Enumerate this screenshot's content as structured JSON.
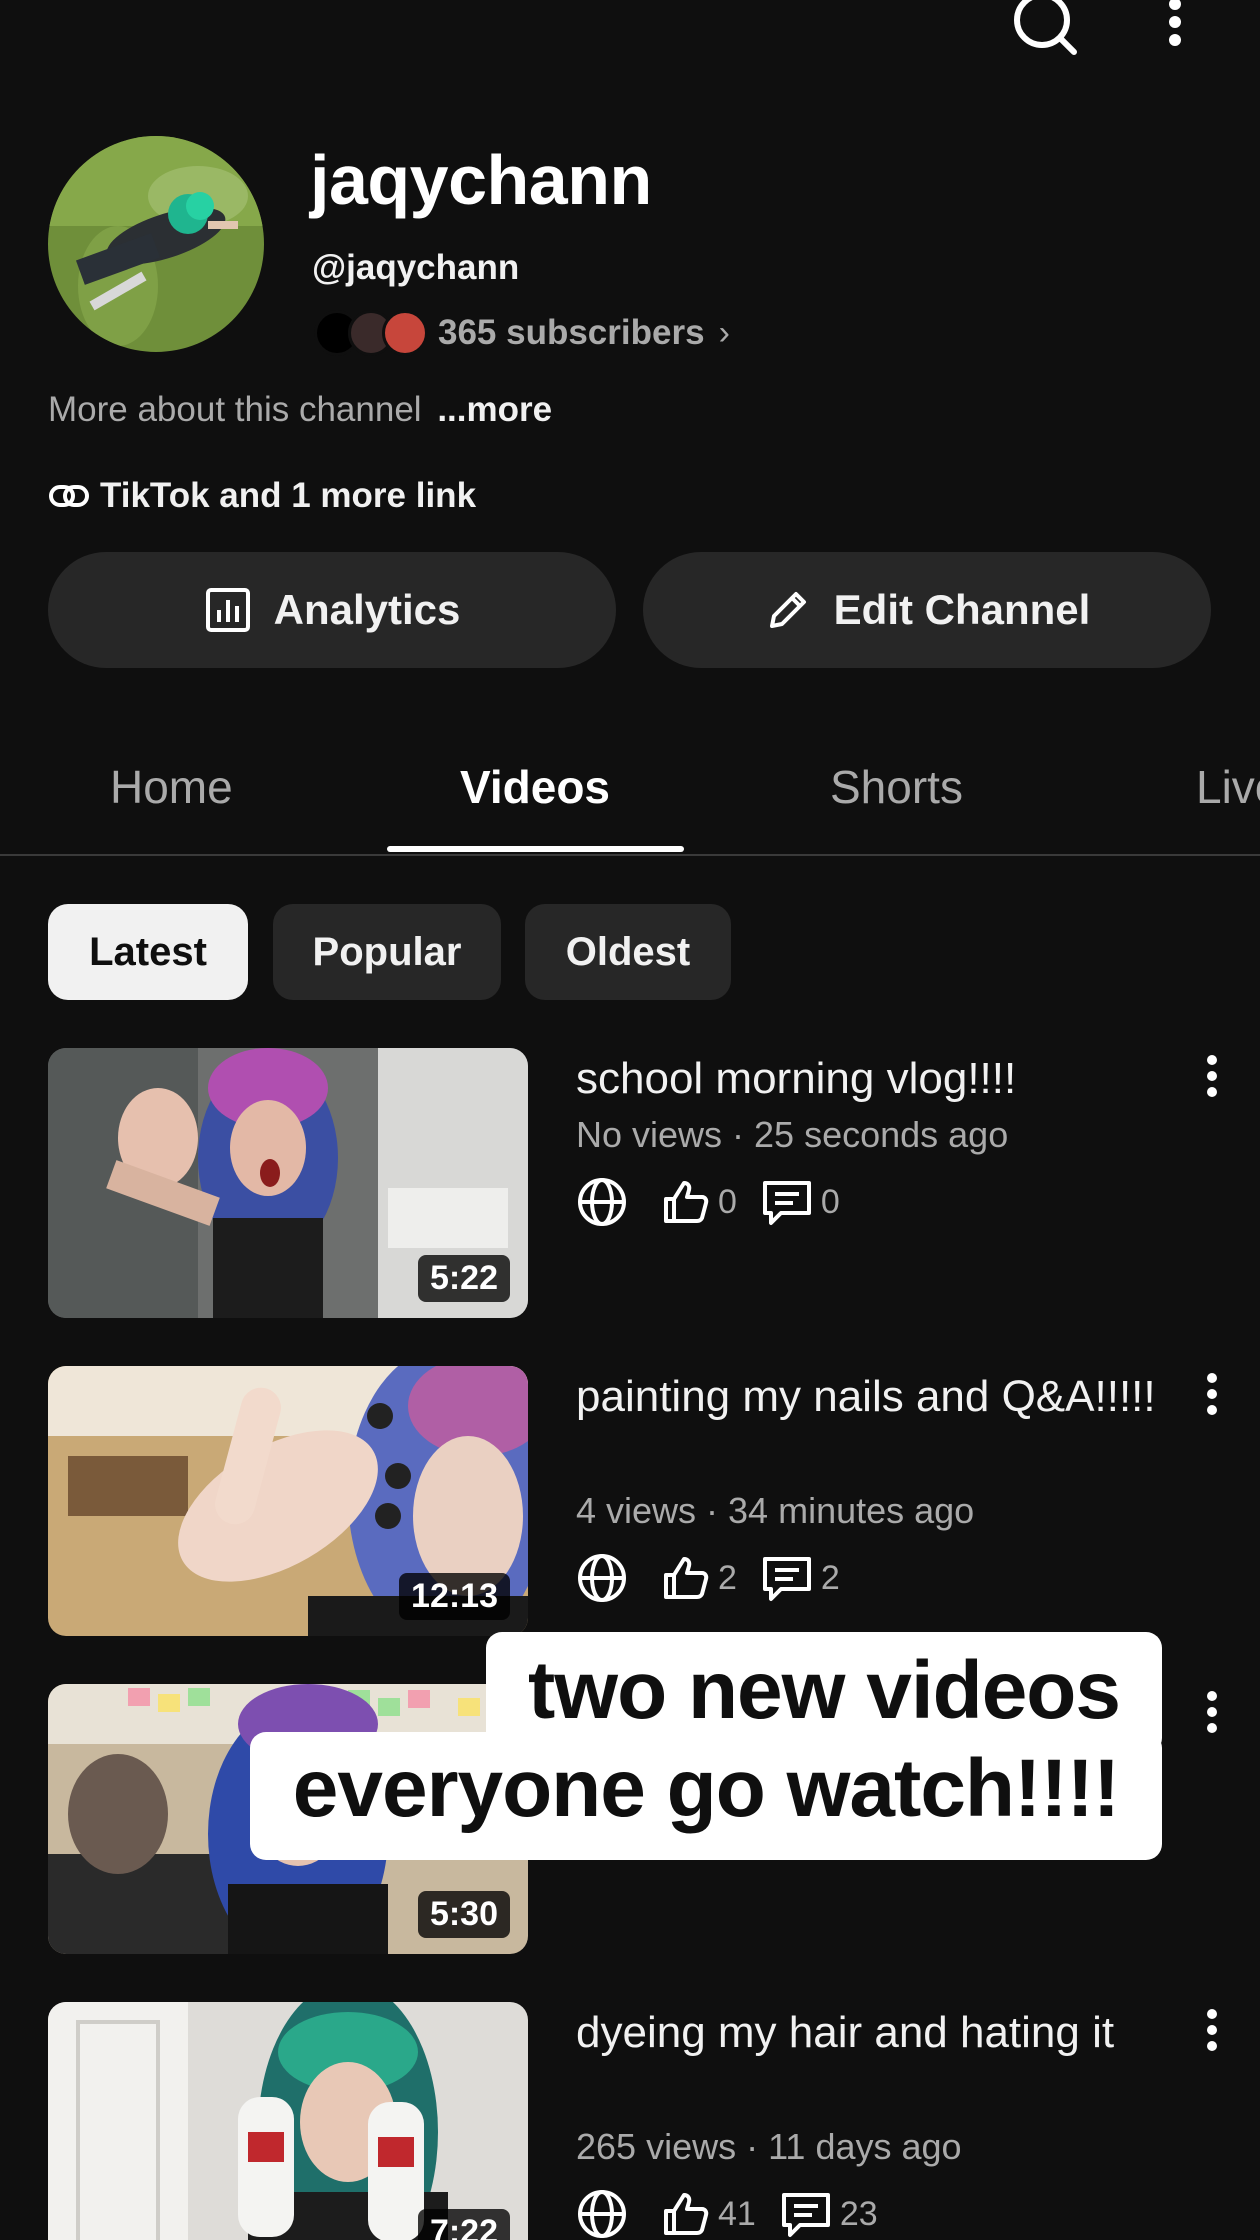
{
  "header": {
    "search_icon": "search-icon",
    "more_icon": "more-vert-icon"
  },
  "channel": {
    "name": "jaqychann",
    "handle": "@jaqychann",
    "subscribers": "365 subscribers",
    "about": "More about this channel",
    "about_more": "...more",
    "links": "TikTok and 1 more link"
  },
  "actions": {
    "analytics_label": "Analytics",
    "edit_label": "Edit Channel"
  },
  "tabs": [
    {
      "label": "Home"
    },
    {
      "label": "Videos",
      "active": true
    },
    {
      "label": "Shorts"
    },
    {
      "label": "Live"
    }
  ],
  "sort_chips": [
    {
      "label": "Latest",
      "active": true
    },
    {
      "label": "Popular"
    },
    {
      "label": "Oldest"
    }
  ],
  "videos": [
    {
      "title": "school morning vlog!!!!",
      "meta": "No views · 25 seconds ago",
      "likes": "0",
      "comments": "0",
      "duration": "5:22"
    },
    {
      "title": "painting my nails and Q&A!!!!!",
      "meta": "4 views · 34 minutes ago",
      "likes": "2",
      "comments": "2",
      "duration": "12:13"
    },
    {
      "title": "",
      "meta": "",
      "likes": "",
      "comments": "",
      "duration": "5:30"
    },
    {
      "title": "dyeing my hair and hating it",
      "meta": "265 views · 11 days ago",
      "likes": "41",
      "comments": "23",
      "duration": "7:22"
    }
  ],
  "overlay": {
    "line1": "two new videos",
    "line2": "everyone go watch!!!!"
  },
  "colors": {
    "background": "#0f0f0f",
    "chip_bg": "#272727",
    "secondary_text": "#aaaaaa",
    "primary_text": "#f1f1f1"
  }
}
